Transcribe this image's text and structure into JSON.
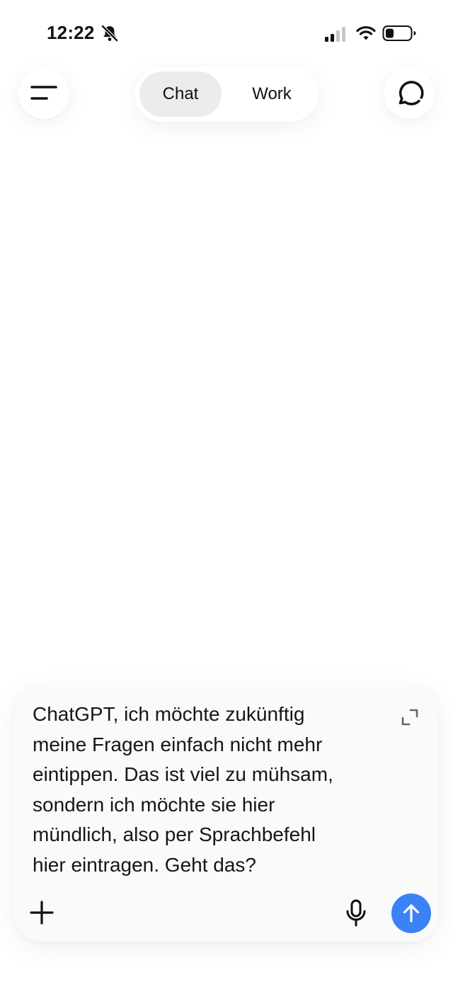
{
  "status_bar": {
    "time": "12:22",
    "icons": [
      "bell-slash-icon",
      "signal-icon",
      "wifi-icon",
      "battery-icon"
    ]
  },
  "header": {
    "menu_icon": "menu-icon",
    "new_chat_icon": "new-chat-icon",
    "mode_tabs": [
      {
        "label": "Chat",
        "selected": true
      },
      {
        "label": "Work",
        "selected": false
      }
    ]
  },
  "composer": {
    "text": "ChatGPT, ich möchte zukünftig\nmeine Fragen einfach nicht mehr\neintippen. Das ist viel zu mühsam,\nsondern ich möchte sie hier\nmündlich, also per Sprachbefehl\nhier eintragen. Geht das?",
    "icons": [
      "expand-icon",
      "plus-icon",
      "microphone-icon",
      "send-arrow-icon"
    ]
  },
  "colors": {
    "send_button": "#3b82f6",
    "selected_tab": "#ececec",
    "composer_background": "#fafafa"
  }
}
